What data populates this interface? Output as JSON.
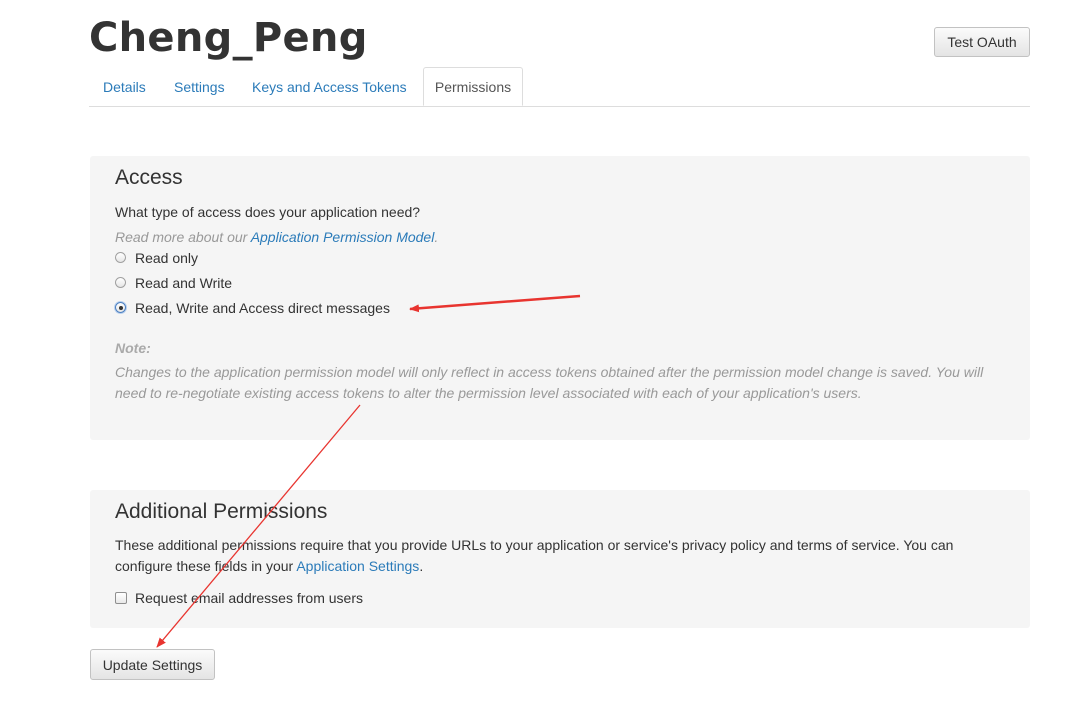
{
  "app": {
    "title": "Cheng_Peng"
  },
  "header": {
    "test_oauth_label": "Test OAuth"
  },
  "tabs": [
    {
      "label": "Details",
      "active": false
    },
    {
      "label": "Settings",
      "active": false
    },
    {
      "label": "Keys and Access Tokens",
      "active": false
    },
    {
      "label": "Permissions",
      "active": true
    }
  ],
  "access": {
    "heading": "Access",
    "question": "What type of access does your application need?",
    "read_more_prefix": "Read more about our ",
    "read_more_link": "Application Permission Model",
    "read_more_suffix": ".",
    "options": [
      {
        "label": "Read only",
        "checked": false
      },
      {
        "label": "Read and Write",
        "checked": false
      },
      {
        "label": "Read, Write and Access direct messages",
        "checked": true
      }
    ],
    "note_label": "Note:",
    "note_line1": "Changes to the application permission model will only reflect in access tokens obtained after the permission model change is saved. You will",
    "note_line2": "need to re-negotiate existing access tokens to alter the permission level associated with each of your application's users."
  },
  "additional": {
    "heading": "Additional Permissions",
    "desc_line1": "These additional permissions require that you provide URLs to your application or service's privacy policy and terms of service. You can",
    "desc_line2_prefix": "configure these fields in your ",
    "desc_line2_link": "Application Settings",
    "desc_line2_suffix": ".",
    "checkbox_label": "Request email addresses from users",
    "checkbox_checked": false
  },
  "footer": {
    "update_label": "Update Settings"
  },
  "colors": {
    "link": "#2b7bb9",
    "panel_bg": "#f5f5f5",
    "annotation_arrow": "#e8342f"
  }
}
